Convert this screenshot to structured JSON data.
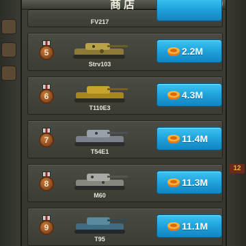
{
  "shop": {
    "title": "商店",
    "close_icon": "close-icon"
  },
  "items": [
    {
      "rank": "",
      "name": "FV217",
      "price": "",
      "camo": "#9a8a4a"
    },
    {
      "rank": "5",
      "name": "Strv103",
      "price": "2.2M",
      "camo": "#b7a24a"
    },
    {
      "rank": "6",
      "name": "T110E3",
      "price": "4.3M",
      "camo": "#c8a42e"
    },
    {
      "rank": "7",
      "name": "T54E1",
      "price": "11.4M",
      "camo": "#9aa0a8"
    },
    {
      "rank": "8",
      "name": "M60",
      "price": "11.3M",
      "camo": "#a9aaa6"
    },
    {
      "rank": "9",
      "name": "T95",
      "price": "11.1M",
      "camo": "#5a8aa0"
    }
  ],
  "side": {
    "right_tags": [
      "12"
    ]
  },
  "colors": {
    "button": "#1e9ed8",
    "panel": "#3d3f37"
  }
}
